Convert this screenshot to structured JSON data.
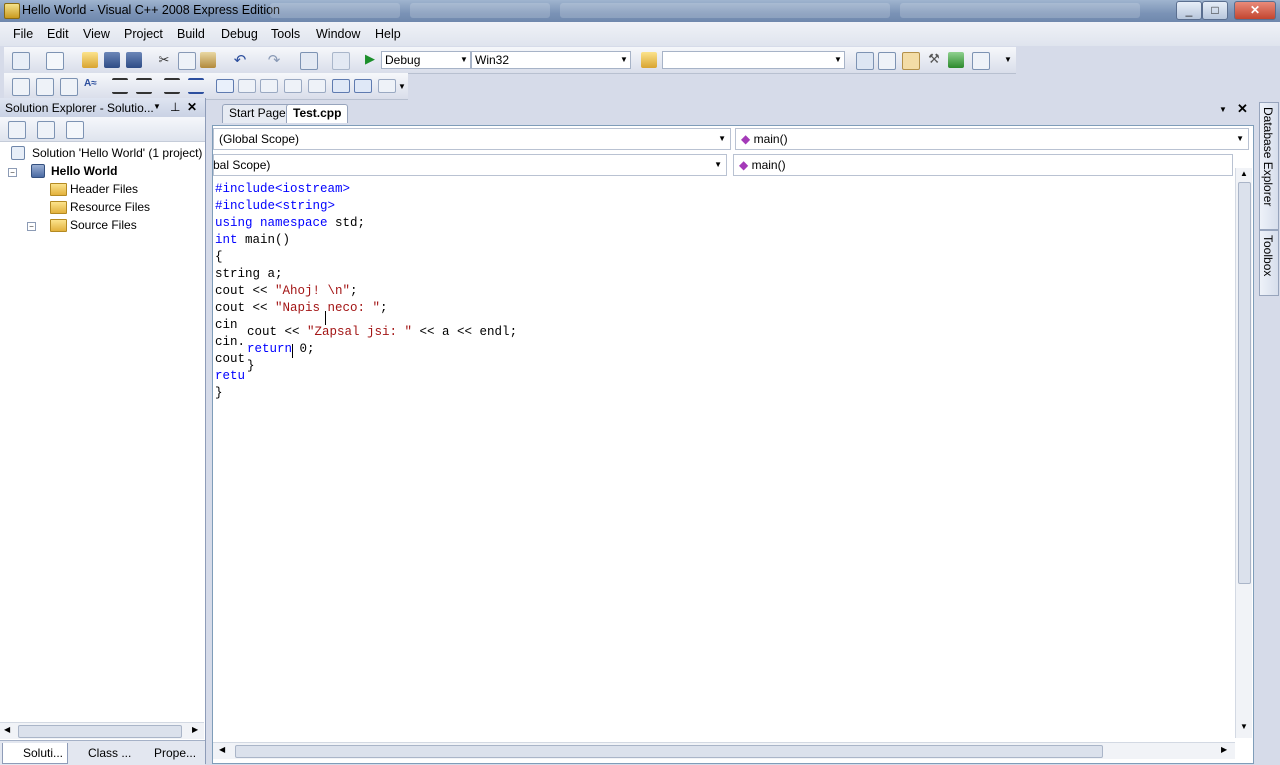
{
  "window": {
    "title": "Hello World - Visual C++ 2008 Express Edition",
    "minimize": "_",
    "maximize": "□",
    "close": "✕"
  },
  "menu": [
    "File",
    "Edit",
    "View",
    "Project",
    "Build",
    "Debug",
    "Tools",
    "Window",
    "Help"
  ],
  "toolbar": {
    "config": "Debug",
    "platform": "Win32",
    "find_value": ""
  },
  "solution_explorer": {
    "title": "Solution Explorer - Solutio...",
    "solution": "Solution 'Hello World' (1 project)",
    "project": "Hello World",
    "folders": [
      "Header Files",
      "Resource Files",
      "Source Files"
    ],
    "tabs": [
      "Soluti...",
      "Class ...",
      "Prope..."
    ],
    "pin": "⊥",
    "close": "✕"
  },
  "editor": {
    "tabs": [
      "Start Page",
      "Test.cpp"
    ],
    "active_tab": "Test.cpp",
    "scope1": "(Global Scope)",
    "member1": "main()",
    "scope2": "bal Scope)",
    "member2": "main()",
    "close": "✕"
  },
  "code_lines": [
    [
      {
        "t": "#include<iostream>",
        "c": "kw"
      }
    ],
    [
      {
        "t": "#include<string>",
        "c": "kw"
      }
    ],
    [
      {
        "t": "using namespace",
        "c": "kw"
      },
      {
        "t": " std;",
        "c": ""
      }
    ],
    [
      {
        "t": "int",
        "c": "kw"
      },
      {
        "t": " main()",
        "c": ""
      }
    ],
    [
      {
        "t": "{",
        "c": ""
      }
    ],
    [
      {
        "t": "string a;",
        "c": ""
      }
    ],
    [
      {
        "t": "cout << ",
        "c": ""
      },
      {
        "t": "\"Ahoj! \\n\"",
        "c": "str"
      },
      {
        "t": ";",
        "c": ""
      }
    ],
    [
      {
        "t": "cout << ",
        "c": ""
      },
      {
        "t": "\"Napis neco: \"",
        "c": "str"
      },
      {
        "t": ";",
        "c": ""
      }
    ],
    [
      {
        "t": "cin",
        "c": ""
      }
    ],
    [
      {
        "t": "cin.",
        "c": ""
      }
    ],
    [
      {
        "t": "cout",
        "c": ""
      }
    ],
    [
      {
        "t": "retu",
        "c": "kw"
      }
    ],
    [
      {
        "t": "}",
        "c": ""
      }
    ]
  ],
  "overlay_lines": [
    [
      {
        "t": "cout << ",
        "c": ""
      },
      {
        "t": "\"Zapsal jsi: \"",
        "c": "str"
      },
      {
        "t": " << a << endl;",
        "c": ""
      }
    ],
    [
      {
        "t": "return",
        "c": "kw"
      },
      {
        "t": " 0;",
        "c": ""
      }
    ],
    [
      {
        "t": "}",
        "c": ""
      }
    ]
  ],
  "right_tabs": [
    "Database Explorer",
    "Toolbox"
  ],
  "colors": {
    "keyword": "#0000ff",
    "string": "#a31515"
  }
}
